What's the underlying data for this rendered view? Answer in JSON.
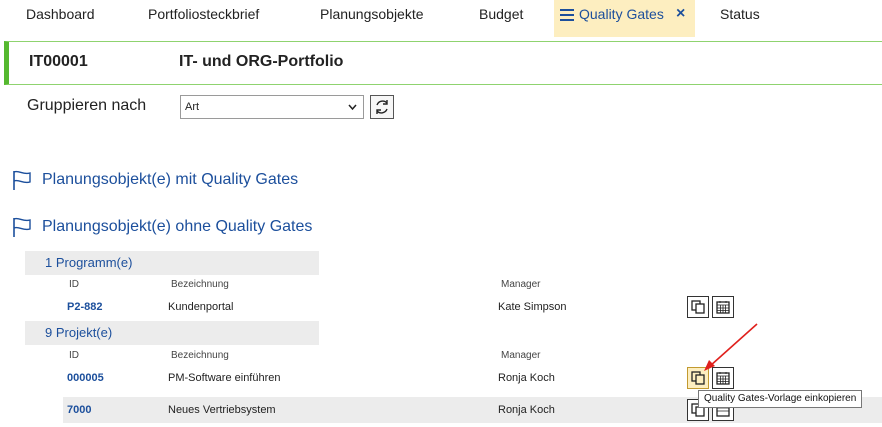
{
  "tabs": [
    {
      "label": "Dashboard"
    },
    {
      "label": "Portfoliosteckbrief"
    },
    {
      "label": "Planungsobjekte"
    },
    {
      "label": "Budget"
    },
    {
      "label": "Quality Gates"
    },
    {
      "label": "Status"
    }
  ],
  "header": {
    "id": "IT00001",
    "title": "IT- und ORG-Portfolio"
  },
  "grouping": {
    "label": "Gruppieren nach",
    "selected": "Art"
  },
  "sections": {
    "with_gates": "Planungsobjekt(e) mit Quality Gates",
    "without_gates": "Planungsobjekt(e) ohne Quality Gates"
  },
  "columns": {
    "id": "ID",
    "name": "Bezeichnung",
    "manager": "Manager"
  },
  "groups": [
    {
      "title": "1 Programm(e)",
      "rows": [
        {
          "id": "P2-882",
          "name": "Kundenportal",
          "manager": "Kate Simpson"
        }
      ]
    },
    {
      "title": "9 Projekt(e)",
      "rows": [
        {
          "id": "000005",
          "name": "PM-Software einführen",
          "manager": "Ronja Koch"
        },
        {
          "id": "7000",
          "name": "Neues Vertriebsystem",
          "manager": "Ronja Koch"
        }
      ]
    }
  ],
  "tooltip": "Quality Gates-Vorlage einkopieren",
  "colors": {
    "accent": "#1c4f9c",
    "active_tab": "#fdeec0",
    "header_border": "#55b82f",
    "arrow": "#e0201c"
  },
  "icons": [
    "menu-icon",
    "close-icon",
    "refresh-icon",
    "flag-icon",
    "copy-template-icon",
    "calendar-icon"
  ]
}
